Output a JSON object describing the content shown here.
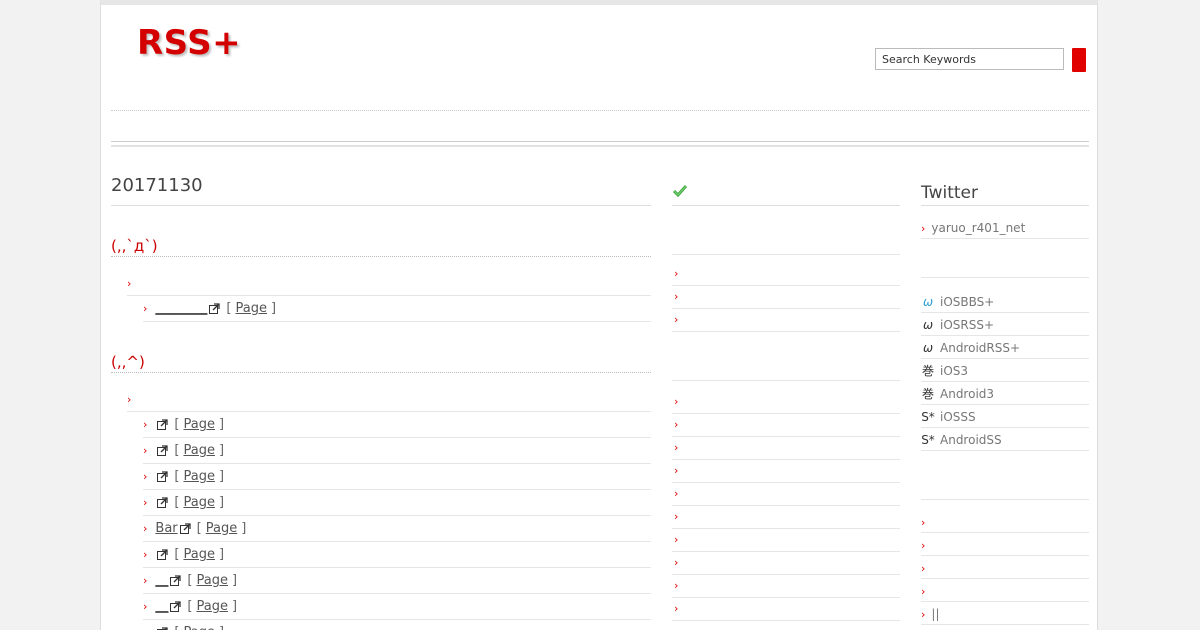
{
  "site": {
    "logo": "RSS+"
  },
  "search": {
    "placeholder": "Search Keywords",
    "value": "Search Keywords"
  },
  "main": {
    "date": "20171130",
    "categories": [
      {
        "title": "(,,`д`)",
        "rows": [
          {
            "level": 1,
            "text": ""
          },
          {
            "level": 2,
            "link": "________",
            "page": "Page"
          }
        ]
      },
      {
        "title": "(,,^)",
        "rows": [
          {
            "level": 1,
            "text": ""
          },
          {
            "level": 2,
            "link": "",
            "page": "Page"
          },
          {
            "level": 2,
            "link": "",
            "page": "Page"
          },
          {
            "level": 2,
            "link": "",
            "page": "Page"
          },
          {
            "level": 2,
            "link": "",
            "page": "Page"
          },
          {
            "level": 2,
            "link": "Bar",
            "page": "Page"
          },
          {
            "level": 2,
            "link": "",
            "page": "Page"
          },
          {
            "level": 2,
            "link": "__",
            "page": "Page"
          },
          {
            "level": 2,
            "link": "__",
            "page": "Page"
          },
          {
            "level": 2,
            "link": "",
            "page": "Page"
          }
        ]
      }
    ],
    "bracket_open": "[",
    "bracket_close": "]"
  },
  "middle": {
    "check_icon": "checkmark-icon",
    "rows_group1": [
      "",
      "",
      ""
    ],
    "rows_group2": [
      "",
      "",
      "",
      "",
      "",
      "",
      "",
      "",
      "",
      ""
    ]
  },
  "side": {
    "twitter_title": "Twitter",
    "twitter_user": "yaruo_r401_net",
    "apps": [
      {
        "icon": "ω",
        "name": "iOSBBS+",
        "color": "#2aa0d6"
      },
      {
        "icon": "ω",
        "name": "iOSRSS+",
        "color": "#333333"
      },
      {
        "icon": "ω",
        "name": "AndroidRSS+",
        "color": "#333333"
      },
      {
        "icon": "巻",
        "name": "iOS3",
        "color": "#333333"
      },
      {
        "icon": "巻",
        "name": "Android3",
        "color": "#333333"
      },
      {
        "icon": "S*",
        "name": "iOSSS",
        "color": "#333333"
      },
      {
        "icon": "S*",
        "name": "AndroidSS",
        "color": "#333333"
      }
    ],
    "bottom_rows": [
      "",
      "",
      "",
      "",
      "||"
    ]
  },
  "colors": {
    "accent": "#d40000",
    "check": "#3aa53a"
  }
}
